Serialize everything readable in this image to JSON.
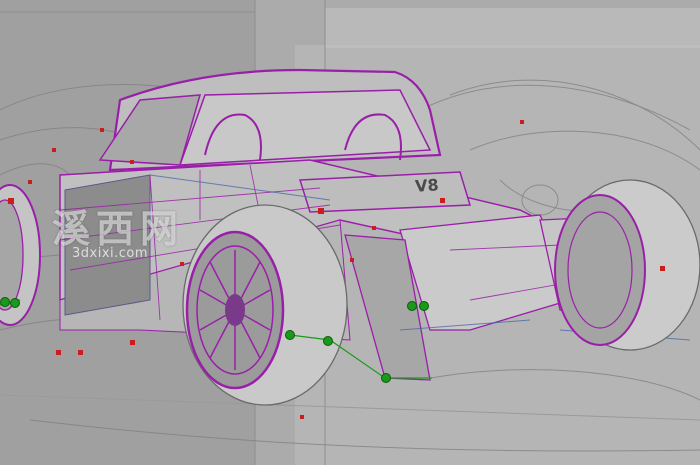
{
  "viewport": {
    "title": "",
    "background": "#a2a2a2"
  },
  "model": {
    "name": "",
    "badge": "V8",
    "wire_color": "#9a1fa8",
    "body_color": "#bdbdbd",
    "control_point_color": "#1a9a1a",
    "vertex_color": "#c81e1e"
  },
  "watermark": {
    "chinese": "溪西网",
    "url": "3dxixi.com"
  }
}
